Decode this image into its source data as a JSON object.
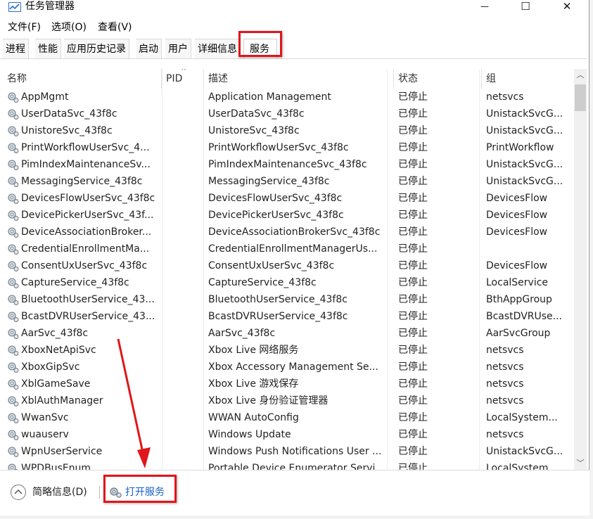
{
  "window": {
    "title": "任务管理器",
    "minimize_glyph": "—",
    "maximize_glyph": "☐",
    "close_glyph": "✕"
  },
  "menu": [
    "文件(F)",
    "选项(O)",
    "查看(V)"
  ],
  "tabs": [
    {
      "label": "进程"
    },
    {
      "label": "性能"
    },
    {
      "label": "应用历史记录"
    },
    {
      "label": "启动"
    },
    {
      "label": "用户"
    },
    {
      "label": "详细信息"
    },
    {
      "label": "服务",
      "active": true
    }
  ],
  "columns": {
    "name": "名称",
    "pid": "PID",
    "desc": "描述",
    "status": "状态",
    "group": "组"
  },
  "services": [
    {
      "name": "AppMgmt",
      "desc": "Application Management",
      "status": "已停止",
      "group": "netsvcs"
    },
    {
      "name": "UserDataSvc_43f8c",
      "desc": "UserDataSvc_43f8c",
      "status": "已停止",
      "group": "UnistackSvcG..."
    },
    {
      "name": "UnistoreSvc_43f8c",
      "desc": "UnistoreSvc_43f8c",
      "status": "已停止",
      "group": "UnistackSvcG..."
    },
    {
      "name": "PrintWorkflowUserSvc_4...",
      "desc": "PrintWorkflowUserSvc_43f8c",
      "status": "已停止",
      "group": "PrintWorkflow"
    },
    {
      "name": "PimIndexMaintenanceSv...",
      "desc": "PimIndexMaintenanceSvc_43f8c",
      "status": "已停止",
      "group": "UnistackSvcG..."
    },
    {
      "name": "MessagingService_43f8c",
      "desc": "MessagingService_43f8c",
      "status": "已停止",
      "group": "UnistackSvcG..."
    },
    {
      "name": "DevicesFlowUserSvc_43f8c",
      "desc": "DevicesFlowUserSvc_43f8c",
      "status": "已停止",
      "group": "DevicesFlow"
    },
    {
      "name": "DevicePickerUserSvc_43f...",
      "desc": "DevicePickerUserSvc_43f8c",
      "status": "已停止",
      "group": "DevicesFlow"
    },
    {
      "name": "DeviceAssociationBroker...",
      "desc": "DeviceAssociationBrokerSvc_43f8c",
      "status": "已停止",
      "group": "DevicesFlow"
    },
    {
      "name": "CredentialEnrollmentMa...",
      "desc": "CredentialEnrollmentManagerUs...",
      "status": "已停止",
      "group": ""
    },
    {
      "name": "ConsentUxUserSvc_43f8c",
      "desc": "ConsentUxUserSvc_43f8c",
      "status": "已停止",
      "group": "DevicesFlow"
    },
    {
      "name": "CaptureService_43f8c",
      "desc": "CaptureService_43f8c",
      "status": "已停止",
      "group": "LocalService"
    },
    {
      "name": "BluetoothUserService_43...",
      "desc": "BluetoothUserService_43f8c",
      "status": "已停止",
      "group": "BthAppGroup"
    },
    {
      "name": "BcastDVRUserService_43...",
      "desc": "BcastDVRUserService_43f8c",
      "status": "已停止",
      "group": "BcastDVRUse..."
    },
    {
      "name": "AarSvc_43f8c",
      "desc": "AarSvc_43f8c",
      "status": "已停止",
      "group": "AarSvcGroup"
    },
    {
      "name": "XboxNetApiSvc",
      "desc": "Xbox Live 网络服务",
      "status": "已停止",
      "group": "netsvcs"
    },
    {
      "name": "XboxGipSvc",
      "desc": "Xbox Accessory Management Se...",
      "status": "已停止",
      "group": "netsvcs"
    },
    {
      "name": "XblGameSave",
      "desc": "Xbox Live 游戏保存",
      "status": "已停止",
      "group": "netsvcs"
    },
    {
      "name": "XblAuthManager",
      "desc": "Xbox Live 身份验证管理器",
      "status": "已停止",
      "group": "netsvcs"
    },
    {
      "name": "WwanSvc",
      "desc": "WWAN AutoConfig",
      "status": "已停止",
      "group": "LocalSystem..."
    },
    {
      "name": "wuauserv",
      "desc": "Windows Update",
      "status": "已停止",
      "group": "netsvcs"
    },
    {
      "name": "WpnUserService",
      "desc": "Windows Push Notifications User ...",
      "status": "已停止",
      "group": "UnistackSvcG..."
    },
    {
      "name": "WPDBusEnum",
      "desc": "Portable Device Enumerator Servi...",
      "status": "已停止",
      "group": "LocalSystem..."
    }
  ],
  "footer": {
    "fewer_details": "简略信息(D)",
    "open_services": "打开服务"
  },
  "colors": {
    "annotation_red": "#e0161b",
    "link_blue": "#1a63c4"
  }
}
